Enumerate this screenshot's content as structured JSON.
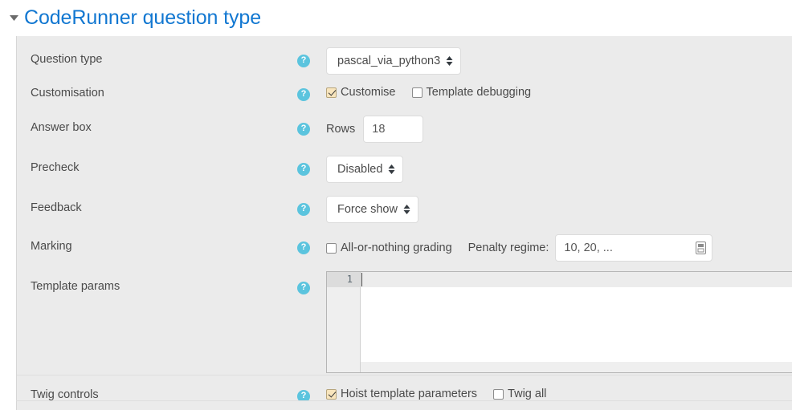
{
  "section": {
    "title": "CodeRunner question type",
    "collapse_icon": "triangle-down-icon",
    "expanded": true
  },
  "help_icon_label": "?",
  "rows": [
    {
      "key": "question_type",
      "label": "Question type",
      "help": "?",
      "control": {
        "type": "select",
        "value": "pascal_via_python3"
      }
    },
    {
      "key": "customisation",
      "label": "Customisation",
      "help": "?",
      "control": {
        "type": "checkboxes",
        "items": [
          {
            "label": "Customise",
            "checked": true
          },
          {
            "label": "Template debugging",
            "checked": false
          }
        ]
      }
    },
    {
      "key": "answer_box",
      "label": "Answer box",
      "help": "?",
      "control": {
        "type": "labeled_input",
        "inline_label": "Rows",
        "value": "18"
      }
    },
    {
      "key": "precheck",
      "label": "Precheck",
      "help": "?",
      "control": {
        "type": "select",
        "value": "Disabled"
      }
    },
    {
      "key": "feedback",
      "label": "Feedback",
      "help": "?",
      "control": {
        "type": "select",
        "value": "Force show"
      }
    },
    {
      "key": "marking",
      "label": "Marking",
      "help": "?",
      "control": {
        "type": "marking",
        "checkbox_label": "All-or-nothing grading",
        "checkbox_checked": false,
        "penalty_label": "Penalty regime:",
        "penalty_value": "10, 20, ...",
        "penalty_placeholder": "10, 20, ...",
        "field_icon": "autofill-save-icon"
      }
    },
    {
      "key": "template_params",
      "label": "Template params",
      "help": "?",
      "control": {
        "type": "code_editor",
        "line_numbers": [
          "1"
        ],
        "content": ""
      }
    },
    {
      "key": "twig_controls",
      "label": "Twig controls",
      "help": "?",
      "control": {
        "type": "checkboxes",
        "items": [
          {
            "label": "Hoist template parameters",
            "checked": true
          },
          {
            "label": "Twig all",
            "checked": false
          }
        ]
      }
    }
  ],
  "colors": {
    "link_blue": "#1177d1",
    "help_blue": "#5bc4de",
    "form_bg": "#ebebeb",
    "label_text": "#4a4a4a",
    "autofill_yellow": "#f8e5bd"
  }
}
